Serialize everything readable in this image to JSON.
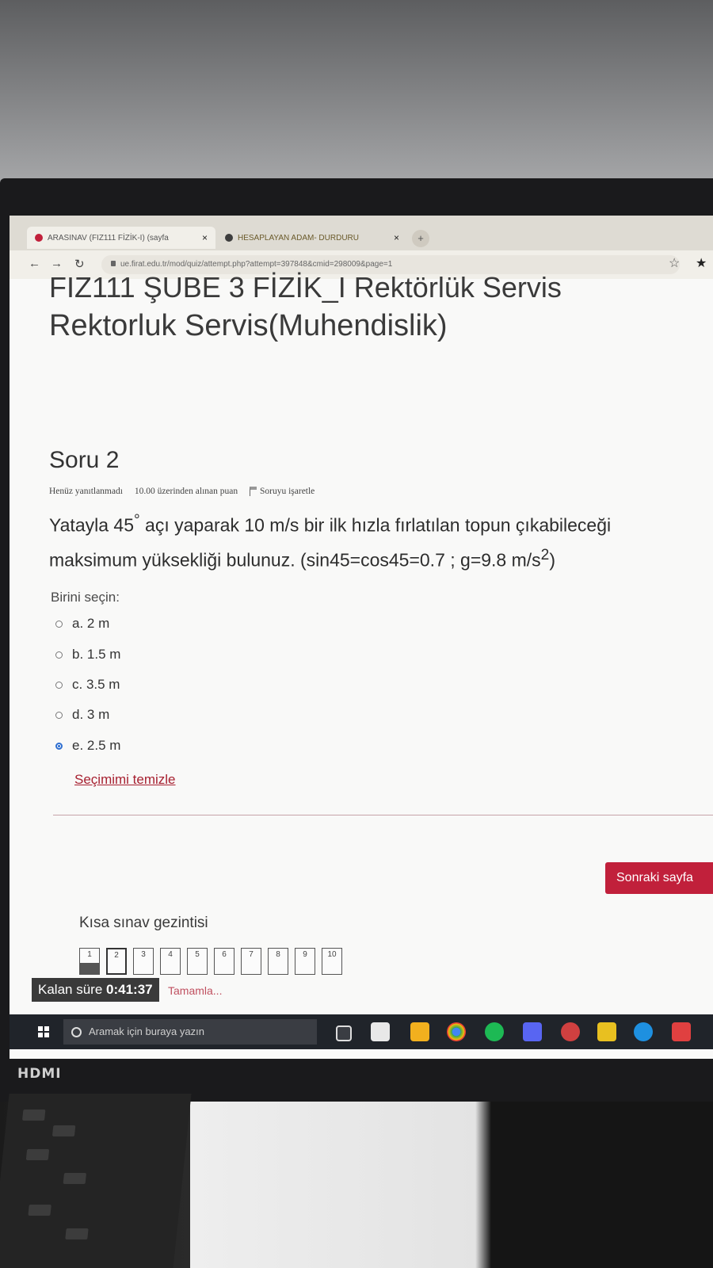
{
  "browser": {
    "tabs": [
      {
        "label": "ARASINAV (FIZ111 FİZİK-I) (sayfa",
        "close": "×"
      },
      {
        "label": "HESAPLAYAN ADAM- DURDURU",
        "close": "×"
      }
    ],
    "new_tab": "+",
    "url": "ue.firat.edu.tr/mod/quiz/attempt.php?attempt=397848&cmid=298009&page=1"
  },
  "course": {
    "line1": "FIZ111 ŞUBE 3 FİZİK_I Rektörlük Servis",
    "line2": "Rektorluk Servis(Muhendislik)"
  },
  "question": {
    "title": "Soru 2",
    "status": "Henüz yanıtlanmadı",
    "points": "10.00 üzerinden alınan puan",
    "flag": "Soruyu işaretle",
    "text_part1": "Yatayla 45",
    "text_deg": "°",
    "text_part2": " açı yaparak 10 m/s bir ilk hızla fırlatılan topun çıkabileceği maksimum yüksekliği bulunuz. (sin45=cos45=0.7  ;   g=9.8 m/s",
    "text_sup": "2",
    "text_end": ")",
    "choose_label": "Birini seçin:",
    "options": [
      {
        "label": "a. 2 m",
        "selected": false
      },
      {
        "label": "b. 1.5 m",
        "selected": false
      },
      {
        "label": "c. 3.5 m",
        "selected": false
      },
      {
        "label": "d. 3 m",
        "selected": false
      },
      {
        "label": "e. 2.5 m",
        "selected": true
      }
    ],
    "clear_choice": "Seçimimi temizle"
  },
  "next_button": "Sonraki sayfa",
  "quiz_nav": {
    "title": "Kısa sınav gezintisi",
    "items": [
      "1",
      "2",
      "3",
      "4",
      "5",
      "6",
      "7",
      "8",
      "9",
      "10"
    ],
    "finish_partial": "Tamamla..."
  },
  "timer": {
    "label": "Kalan süre",
    "value": "0:41:37"
  },
  "taskbar": {
    "search_placeholder": "Aramak için buraya yazın"
  },
  "monitor_brand": "HDMI",
  "colors": {
    "accent": "#c1203b",
    "link": "#a72131",
    "radio_selected": "#2f6fd0"
  }
}
